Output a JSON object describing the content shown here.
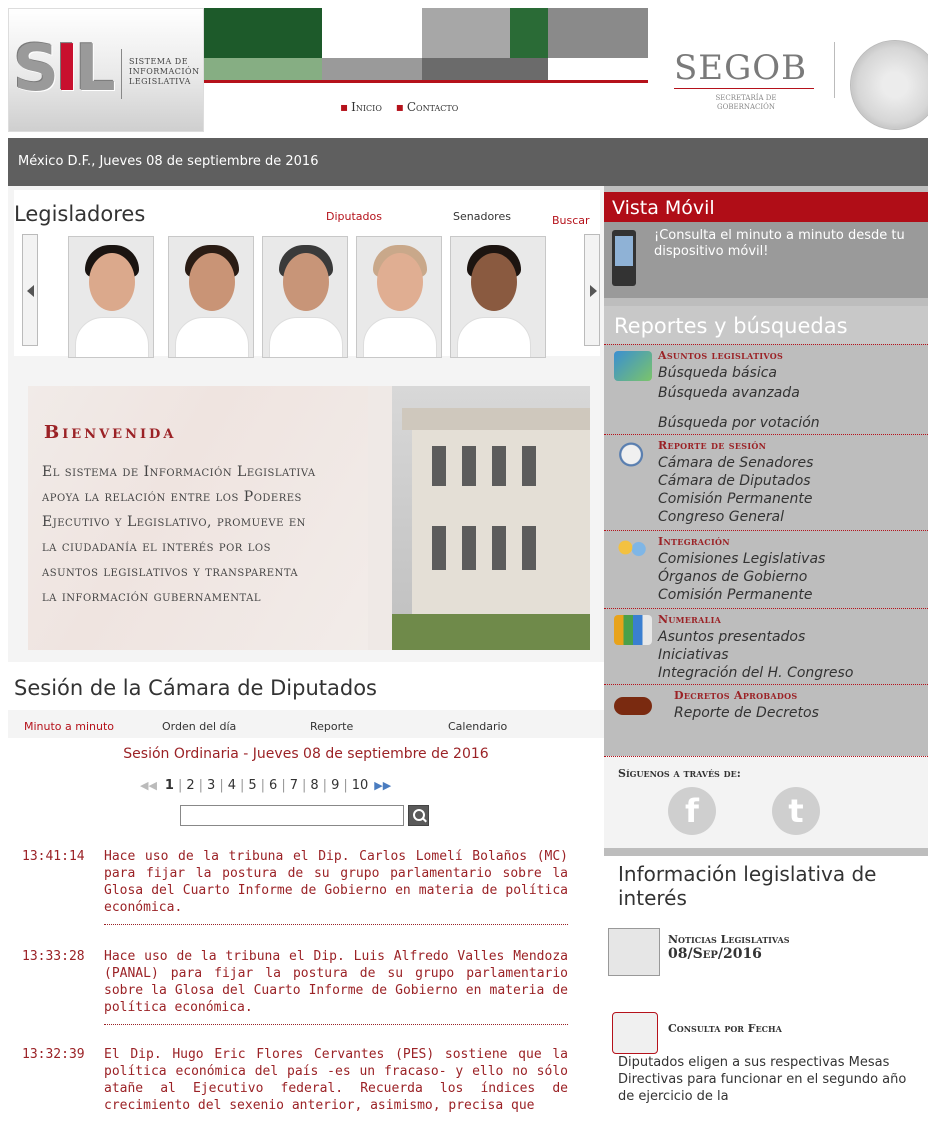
{
  "header": {
    "logo_text": "SIL",
    "logo_subtitle": "SISTEMA DE INFORMACIÓN LEGISLATIVA",
    "nav": [
      {
        "label": "Inicio"
      },
      {
        "label": "Contacto"
      }
    ],
    "agency_title": "SEGOB",
    "agency_subtitle": "SECRETARÍA DE GOBERNACIÓN",
    "colors": {
      "accent": "#b5121b",
      "green_dark": "#1d5a2a",
      "green_light": "#86ae83",
      "gray": "#5f5f5f"
    }
  },
  "date_bar": {
    "text": "México D.F., Jueves 08 de septiembre de 2016"
  },
  "legisladores": {
    "title": "Legisladores",
    "tabs": {
      "diputados": "Diputados",
      "senadores": "Senadores",
      "buscar": "Buscar"
    },
    "photos": [
      {
        "id": "legislador-1",
        "hair": "#1a1411",
        "skin": "#dba98c"
      },
      {
        "id": "legislador-2",
        "hair": "#2a1c14",
        "skin": "#c99476"
      },
      {
        "id": "legislador-3",
        "hair": "#3a3a3a",
        "skin": "#c89578"
      },
      {
        "id": "legislador-4",
        "hair": "#c9a88a",
        "skin": "#e0ae92"
      },
      {
        "id": "legislador-5",
        "hair": "#1c1410",
        "skin": "#8a5a40"
      }
    ]
  },
  "bienvenida": {
    "title": "Bienvenida",
    "lines": [
      "El sistema de Información Legislativa",
      "apoya la relación entre los Poderes",
      "Ejecutivo y Legislativo, promueve en",
      "la ciudadanía el interés por los",
      "asuntos legislativos y transparenta",
      "la información gubernamental"
    ]
  },
  "sesion": {
    "title": "Sesión de la Cámara de Diputados",
    "tabs": {
      "minuto": "Minuto a minuto",
      "orden": "Orden del día",
      "reporte": "Reporte",
      "calendario": "Calendario"
    },
    "subtitle": "Sesión Ordinaria - Jueves 08 de septiembre de 2016",
    "pages": [
      "1",
      "2",
      "3",
      "4",
      "5",
      "6",
      "7",
      "8",
      "9",
      "10"
    ],
    "active_page": "1",
    "search_placeholder": "",
    "entries": [
      {
        "time": "13:41:14",
        "text": "Hace uso de la tribuna el Dip. Carlos Lomelí Bolaños (MC) para fijar la postura de su grupo parlamentario sobre la Glosa del Cuarto Informe de Gobierno en materia de política económica."
      },
      {
        "time": "13:33:28",
        "text": "Hace uso de la tribuna el Dip. Luis Alfredo Valles Mendoza (PANAL) para fijar la postura de su grupo parlamentario sobre la Glosa del Cuarto Informe de Gobierno en materia de política económica."
      },
      {
        "time": "13:32:39",
        "text": "El Dip. Hugo Eric Flores Cervantes (PES) sostiene que la política económica del país -es un fracaso- y ello no sólo atañe al Ejecutivo federal. Recuerda los índices de crecimiento del sexenio anterior, asimismo, precisa que"
      }
    ]
  },
  "vista_movil": {
    "title": "Vista Móvil",
    "text": "¡Consulta el minuto a minuto desde tu dispositivo móvil!"
  },
  "reportes": {
    "title": "Reportes y búsquedas",
    "groups": [
      {
        "head": "Asuntos legislativos",
        "items": [
          "Búsqueda básica",
          "Búsqueda avanzada",
          "Búsqueda por votación"
        ]
      },
      {
        "head": "Reporte de sesión",
        "items": [
          "Cámara de Senadores",
          "Cámara de Diputados",
          "Comisión Permanente",
          "Congreso General"
        ]
      },
      {
        "head": "Integración",
        "items": [
          "Comisiones Legislativas",
          "Órganos de Gobierno",
          "Comisión Permanente"
        ]
      },
      {
        "head": "Numeralia",
        "items": [
          "Asuntos presentados",
          "Iniciativas",
          "Integración del H. Congreso"
        ]
      },
      {
        "head": "Decretos Aprobados",
        "items": [
          "Reporte de Decretos"
        ]
      }
    ]
  },
  "siguenos": {
    "label": "Síguenos a través de:",
    "facebook": "f",
    "twitter": "t"
  },
  "info_legislativa": {
    "title": "Información legislativa de interés",
    "noticias_label": "Noticias Legislativas",
    "noticias_date": "08/Sep/2016",
    "consulta_label": "Consulta por Fecha",
    "text": "Diputados eligen a sus respectivas Mesas Directivas para funcionar en el segundo año de ejercicio de la"
  }
}
